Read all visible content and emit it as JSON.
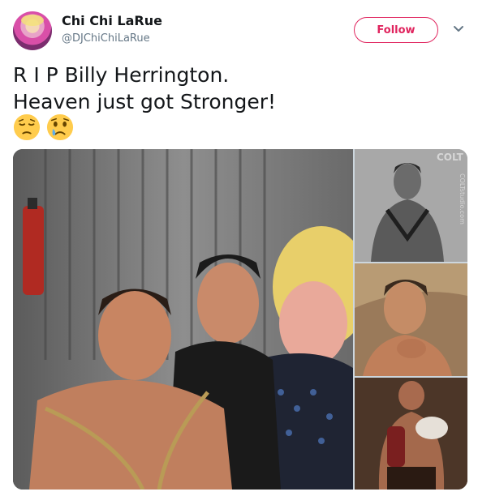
{
  "author": {
    "name": "Chi Chi LaRue",
    "handle": "@DJChiChiLaRue"
  },
  "header": {
    "follow_label": "Follow",
    "menu_icon": "chevron-down-icon"
  },
  "tweet": {
    "line1": "R I P Billy Herrington.",
    "line2": "Heaven just got Stronger!",
    "emojis": [
      "pensive-face-emoji",
      "crying-face-emoji"
    ]
  },
  "media": {
    "main_photo": "group-photo",
    "side_photos": [
      "portrait-harness-photo",
      "portrait-closeup-photo",
      "costume-photo"
    ],
    "watermark_logo": "COLT",
    "watermark_site": "COLTstudio.com"
  },
  "colors": {
    "accent": "#e0245e",
    "text": "#14171a",
    "secondary": "#657786"
  }
}
